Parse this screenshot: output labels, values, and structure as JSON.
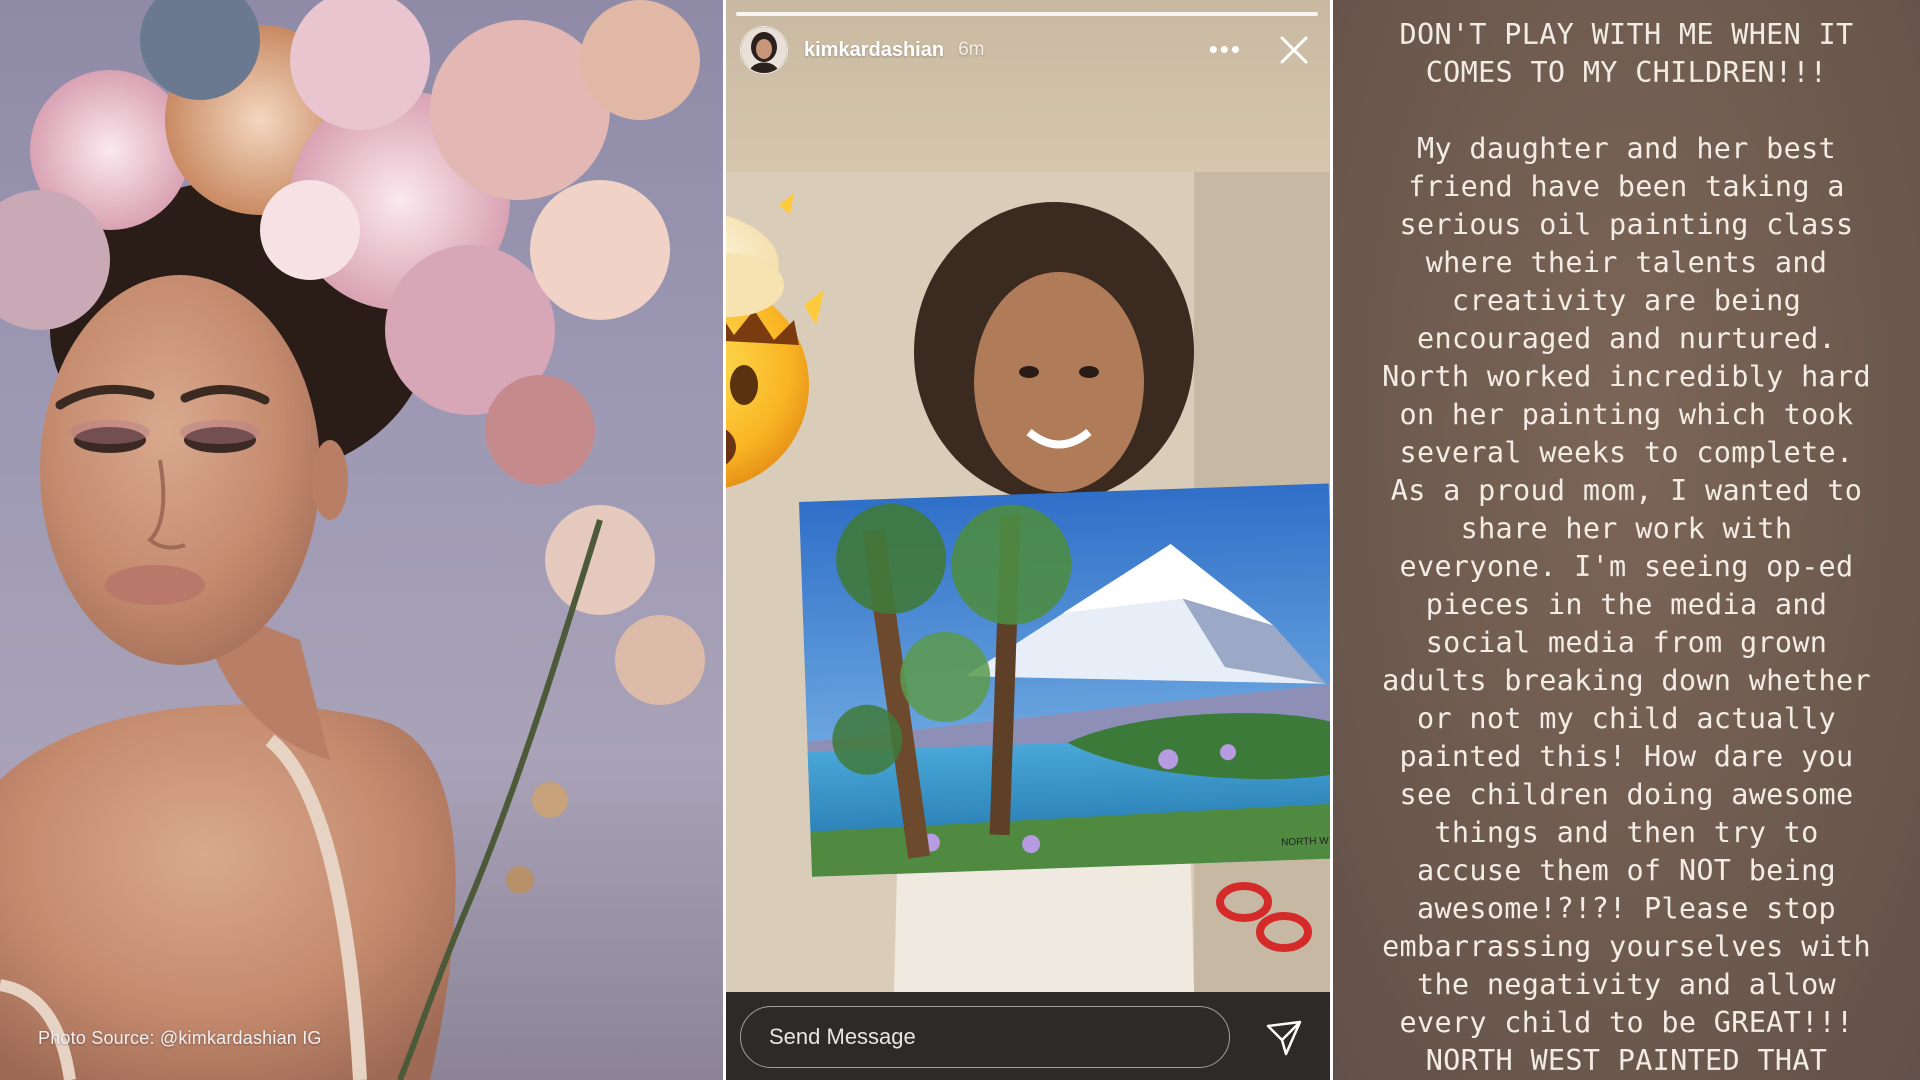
{
  "left_panel": {
    "photo_source": "Photo Source: @kimkardashian IG"
  },
  "story": {
    "username": "kimkardashian",
    "time_ago": "6m",
    "more_label": "•••",
    "send_placeholder": "Send Message",
    "painting_signature": "NORTH W"
  },
  "statement": {
    "text": "DON'T PLAY WITH ME WHEN IT\nCOMES TO MY CHILDREN!!!\n\nMy daughter and her best\nfriend have been taking a\nserious oil painting class\nwhere their talents and\ncreativity are being\nencouraged and nurtured.\nNorth worked incredibly hard\non her painting which took\nseveral weeks to complete.\nAs a proud mom, I wanted to\nshare her work with\neveryone. I'm seeing op-ed\npieces in the media and\nsocial media from grown\nadults breaking down whether\nor not my child actually\npainted this! How dare you\nsee children doing awesome\nthings and then try to\naccuse them of NOT being\nawesome!?!?!  Please stop\nembarrassing yourselves with\nthe negativity and allow\nevery child to be GREAT!!!\nNORTH WEST PAINTED THAT"
  },
  "colors": {
    "story_footer": "#2d2a28",
    "statement_bg": "#6d5a4e",
    "statement_text": "#f3ece4"
  },
  "icons": [
    "mind-blown-emoji-icon",
    "more-icon",
    "close-icon",
    "send-icon",
    "avatar"
  ]
}
